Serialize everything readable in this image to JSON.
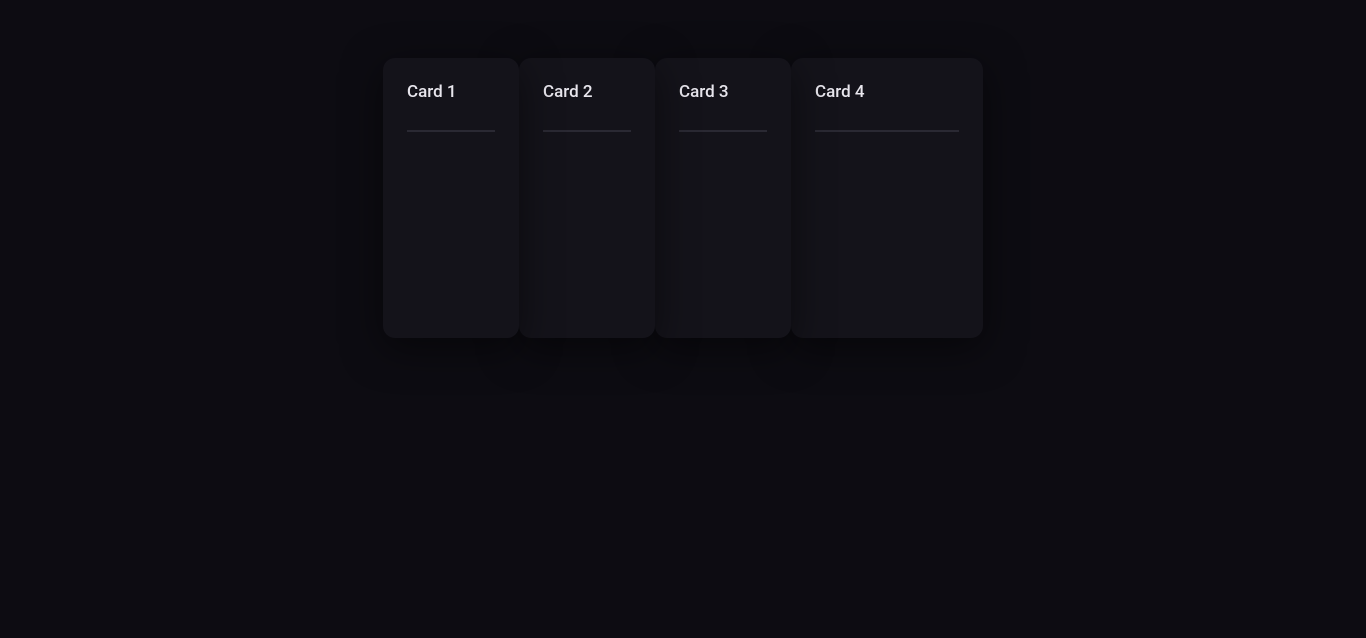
{
  "cards": [
    {
      "title": "Card 1"
    },
    {
      "title": "Card 2"
    },
    {
      "title": "Card 3"
    },
    {
      "title": "Card 4"
    }
  ]
}
